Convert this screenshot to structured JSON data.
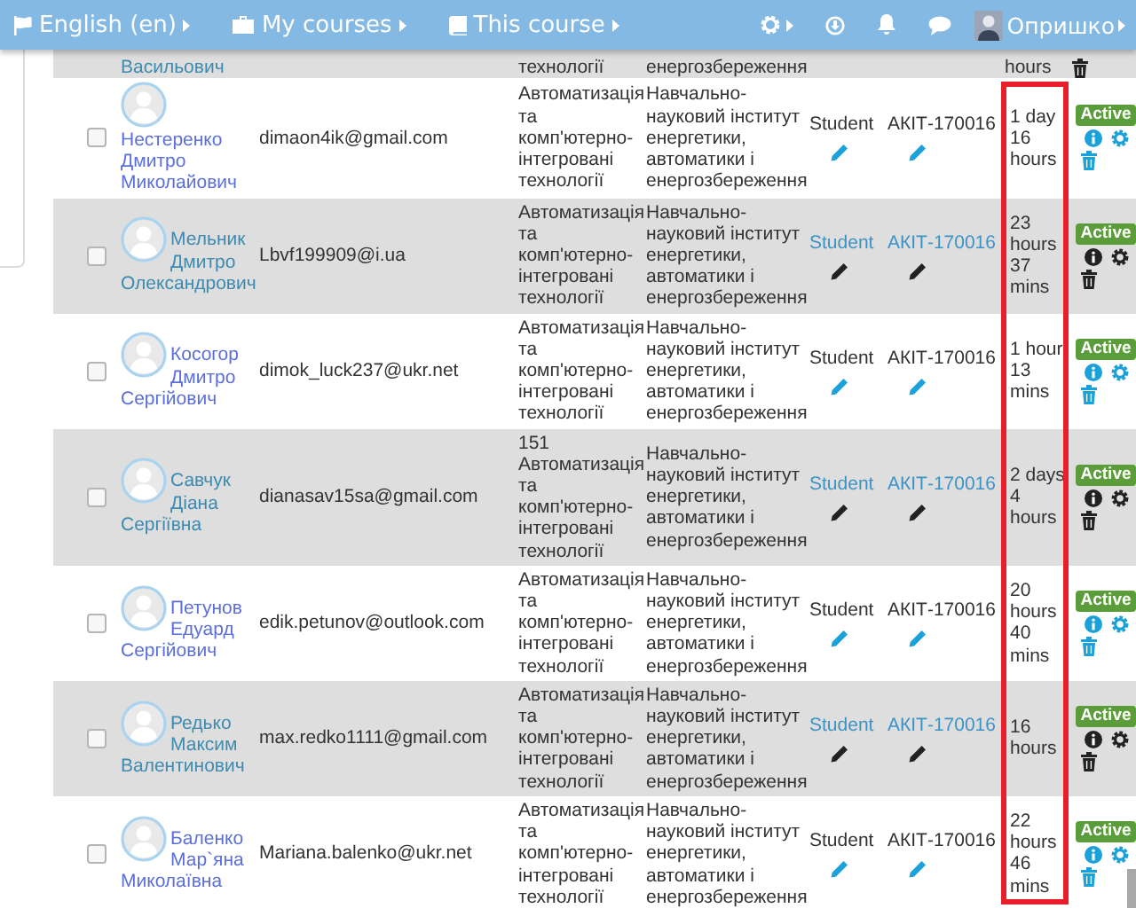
{
  "navbar": {
    "menus": [
      {
        "label": "English (en)",
        "kind": "flag"
      },
      {
        "label": "My courses",
        "kind": "briefcase"
      },
      {
        "label": "This course",
        "kind": "book"
      }
    ],
    "tools": [
      {
        "kind": "gear"
      },
      {
        "kind": "download"
      },
      {
        "kind": "bell"
      },
      {
        "kind": "chat"
      }
    ],
    "user_name": "Опришко"
  },
  "partial_row": {
    "name": "Васильович",
    "specialty": "технології",
    "institute": "енергозбереження",
    "enrolled_time": "hours",
    "highlighted": true
  },
  "rows": [
    {
      "checked": false,
      "name": "Нестеренко Дмитро Миколайович",
      "email": "dimaon4ik@gmail.com",
      "specialty": "Автоматизація та комп'ютерно-інтегровані технології",
      "institute": "Навчально-науковий інститут енергетики, автоматики і енергозбереження",
      "role": "Student",
      "group": "АКІТ-170016",
      "enrolled_time": "1 day 16 hours",
      "status": "Active",
      "highlighted": false
    },
    {
      "checked": false,
      "name": "Мельник Дмитро Олександрович",
      "email": "Lbvf199909@i.ua",
      "specialty": "Автоматизація та комп'ютерно-інтегровані технології",
      "institute": "Навчально-науковий інститут енергетики, автоматики і енергозбереження",
      "role": "Student",
      "group": "АКІТ-170016",
      "enrolled_time": "23 hours 37 mins",
      "status": "Active",
      "highlighted": true
    },
    {
      "checked": false,
      "name": "Косогор Дмитро Сергійович",
      "email": "dimok_luck237@ukr.net",
      "specialty": "Автоматизація та комп'ютерно-інтегровані технології",
      "institute": "Навчально-науковий інститут енергетики, автоматики і енергозбереження",
      "role": "Student",
      "group": "АКІТ-170016",
      "enrolled_time": "1 hour 13 mins",
      "status": "Active",
      "highlighted": false
    },
    {
      "checked": false,
      "name": "Савчук Діана Сергіївна",
      "email": "dianasav15sa@gmail.com",
      "specialty": "151 Автоматизація та комп'ютерно-інтегровані технології",
      "institute": "Навчально-науковий інститут енергетики, автоматики і енергозбереження",
      "role": "Student",
      "group": "АКІТ-170016",
      "enrolled_time": "2 days 4 hours",
      "status": "Active",
      "highlighted": true
    },
    {
      "checked": false,
      "name": "Петунов Едуард Сергійович",
      "email": "edik.petunov@outlook.com",
      "specialty": "Автоматизація та комп'ютерно-інтегровані технології",
      "institute": "Навчально-науковий інститут енергетики, автоматики і енергозбереження",
      "role": "Student",
      "group": "АКІТ-170016",
      "enrolled_time": "20 hours 40 mins",
      "status": "Active",
      "highlighted": false
    },
    {
      "checked": false,
      "name": "Редько Максим Валентинович",
      "email": "max.redko1111@gmail.com",
      "specialty": "Автоматизація та комп'ютерно-інтегровані технології",
      "institute": "Навчально-науковий інститут енергетики, автоматики і енергозбереження",
      "role": "Student",
      "group": "АКІТ-170016",
      "enrolled_time": "16 hours",
      "status": "Active",
      "highlighted": true
    },
    {
      "checked": false,
      "name": "Баленко Мар`яна Миколаївна",
      "email": "Mariana.balenko@ukr.net",
      "specialty": "Автоматизація та комп'ютерно-інтегровані технології",
      "institute": "Навчально-науковий інститут енергетики, автоматики і енергозбереження",
      "role": "Student",
      "group": "АКІТ-170016",
      "enrolled_time": "22 hours 46 mins",
      "status": "Active",
      "highlighted": false
    }
  ]
}
